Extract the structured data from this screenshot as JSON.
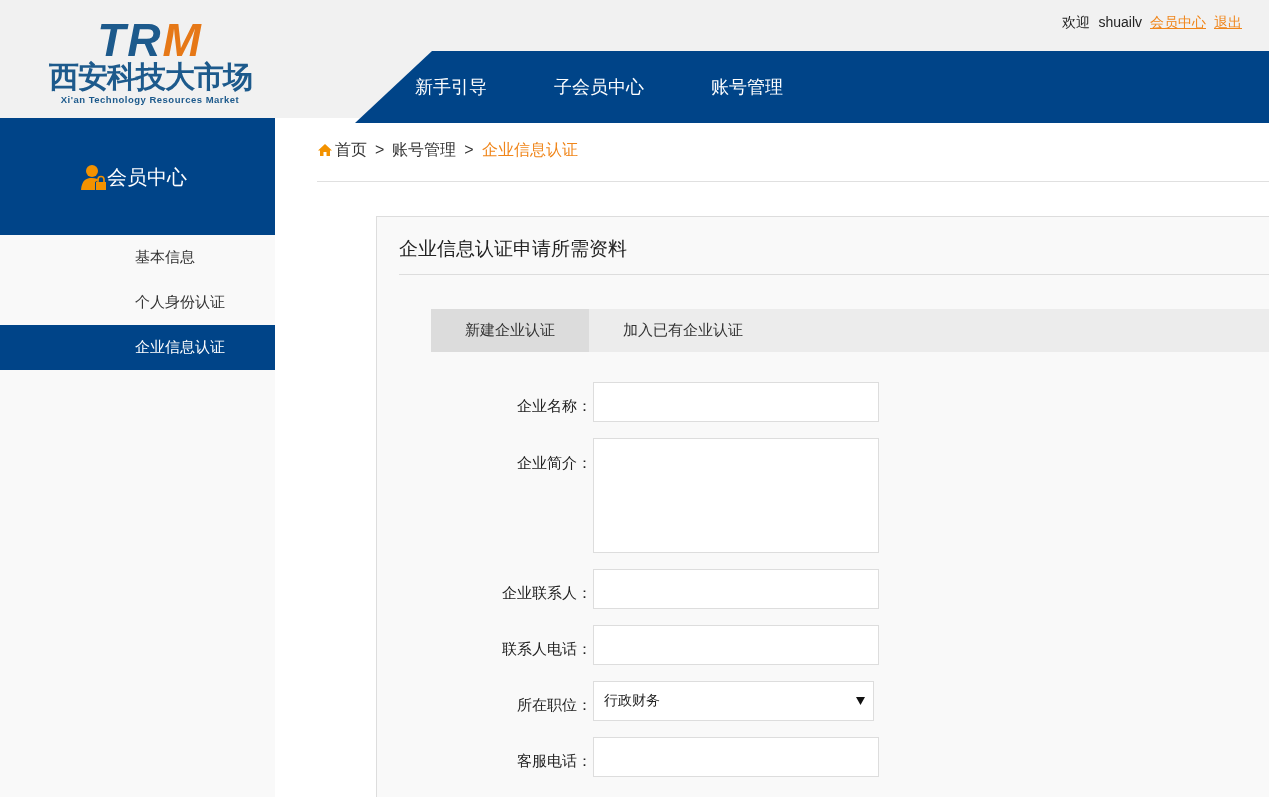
{
  "logo": {
    "mark_left": "TR",
    "mark_right": "M",
    "name": "西安科技大市场",
    "subtitle": "Xi'an Technology Resources Market"
  },
  "user_bar": {
    "greeting": "欢迎",
    "username": "shuailv",
    "links": [
      "会员中心",
      "退出"
    ]
  },
  "nav": [
    {
      "label": "新手引导"
    },
    {
      "label": "子会员中心"
    },
    {
      "label": "账号管理"
    }
  ],
  "sidebar": {
    "title": "会员中心",
    "items": [
      {
        "label": "基本信息",
        "selected": false
      },
      {
        "label": "个人身份认证",
        "selected": false
      },
      {
        "label": "企业信息认证",
        "selected": true
      }
    ]
  },
  "breadcrumb": [
    {
      "label": "首页",
      "current": false
    },
    {
      "label": "账号管理",
      "current": false
    },
    {
      "label": "企业信息认证",
      "current": true
    }
  ],
  "breadcrumb_separator": ">",
  "panel": {
    "title": "企业信息认证申请所需资料",
    "tabs": [
      {
        "label": "新建企业认证",
        "selected": true
      },
      {
        "label": "加入已有企业认证",
        "selected": false
      }
    ],
    "fields": [
      {
        "kind": "input",
        "label": "企业名称："
      },
      {
        "kind": "textarea",
        "label": "企业简介："
      },
      {
        "kind": "input",
        "label": "企业联系人："
      },
      {
        "kind": "input",
        "label": "联系人电话："
      },
      {
        "kind": "select",
        "label": "所在职位：",
        "value": "行政财务"
      },
      {
        "kind": "input",
        "label": "客服电话："
      }
    ]
  }
}
